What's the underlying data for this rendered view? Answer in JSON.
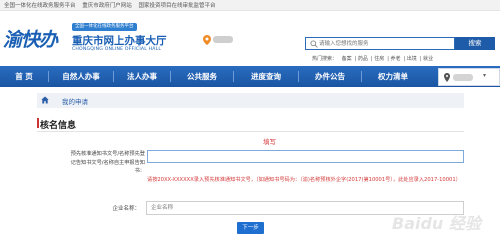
{
  "topbar": {
    "links": [
      "全国一体化在线政务服务平台",
      "重庆市政府门户网站",
      "国家投资项目在线审批监管平台"
    ]
  },
  "header": {
    "logo_text": "渝快办",
    "badge": "全国一体化在线政务服务平台",
    "title": "重庆市网上办事大厅",
    "subtitle": "CHONGQING ONLINE OFFICIAL HALL",
    "search_placeholder": "请输入您想找的服务",
    "search_button": "搜索",
    "hot_label": "热门搜索：",
    "hot_words": [
      "备案",
      "药品",
      "住房",
      "养老",
      "出境",
      "就业"
    ]
  },
  "nav": {
    "items": [
      "首    页",
      "自然人办事",
      "法人办事",
      "公共服务",
      "进度查询",
      "办件公告",
      "权力清单"
    ]
  },
  "breadcrumb": {
    "label": "我的申请"
  },
  "section": {
    "title": "核名信息",
    "fill_tag": "填写"
  },
  "form": {
    "prior_label": "预先核准通知书文号/名称预先登记告知书文号/名称自主申报告知书：",
    "prior_value": "",
    "hint": "请按20XX-XXXXXX录入预先核准通知书文号，（如通知书号码为：（渝)名称预核外企字(2017)第10001号），此处应录入2017-10001）",
    "corp_label": "企业名称：",
    "corp_placeholder": "企业名称",
    "next_button": "下一步"
  },
  "watermark": "Baidu 经验",
  "colors": {
    "brand_blue": "#1a5fb4",
    "nav_blue": "#1a55a2",
    "alert_red": "#d43a3a",
    "button_blue": "#1f6fd1"
  }
}
